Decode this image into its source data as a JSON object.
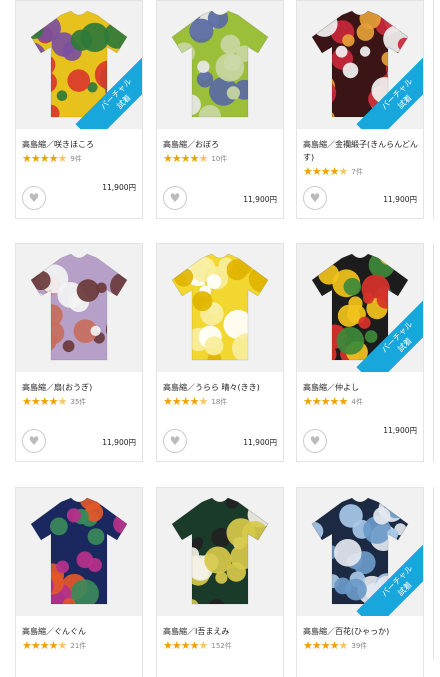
{
  "badge": {
    "line1": "バーチャル",
    "line2": "試着"
  },
  "products": [
    {
      "title": "高島縮／咲きほころ",
      "count": "9件",
      "price": "11,900円",
      "rating": 4.5,
      "badge": true,
      "colors": [
        "#e8c21c",
        "#d93a2c",
        "#2f7a3a",
        "#7a4fa0"
      ]
    },
    {
      "title": "高島縮／おぼろ",
      "count": "10件",
      "price": "11,900円",
      "rating": 4.5,
      "badge": false,
      "colors": [
        "#9cbf3a",
        "#5a6aa3",
        "#c9d7a3",
        "#e7e7e7"
      ]
    },
    {
      "title": "高島縮／金襴緞子(きんらんどんす)",
      "count": "7件",
      "price": "11,900円",
      "rating": 4.5,
      "badge": true,
      "colors": [
        "#3b1416",
        "#c8283a",
        "#f2f2f2",
        "#e6a13a"
      ]
    },
    {
      "title": "高島縮／扇(おうぎ)",
      "count": "35件",
      "price": "11,900円",
      "rating": 4.5,
      "badge": false,
      "colors": [
        "#b6a0c8",
        "#6a3a3a",
        "#f3f3f3",
        "#c86d5d"
      ]
    },
    {
      "title": "高島縮／うらら 晴々(きき)",
      "count": "18件",
      "price": "11,900円",
      "rating": 4.5,
      "badge": false,
      "colors": [
        "#f2d731",
        "#f8ee9c",
        "#ffffff",
        "#e0b400"
      ]
    },
    {
      "title": "高島縮／仲よし",
      "count": "4件",
      "price": "11,900円",
      "rating": 5,
      "badge": true,
      "colors": [
        "#1c1c1c",
        "#d8322a",
        "#f2c21c",
        "#3d8a3a"
      ]
    },
    {
      "title": "高島縮／ぐんぐん",
      "count": "21件",
      "price": "11,900円",
      "rating": 4.5,
      "badge": false,
      "colors": [
        "#1b2860",
        "#e2582a",
        "#b8308c",
        "#3a8a5a"
      ]
    },
    {
      "title": "高島縮／I吾まえみ",
      "count": "152件",
      "price": "11,900円",
      "rating": 4.5,
      "badge": false,
      "colors": [
        "#1a3a2a",
        "#f4f1e6",
        "#d7c94a",
        "#222222"
      ]
    },
    {
      "title": "高島縮／百花(ひゃっか)",
      "count": "39件",
      "price": "11,900円",
      "rating": 4.5,
      "badge": true,
      "colors": [
        "#1b2a42",
        "#e4e8ef",
        "#a8c8e8",
        "#6a9ac8"
      ]
    }
  ]
}
